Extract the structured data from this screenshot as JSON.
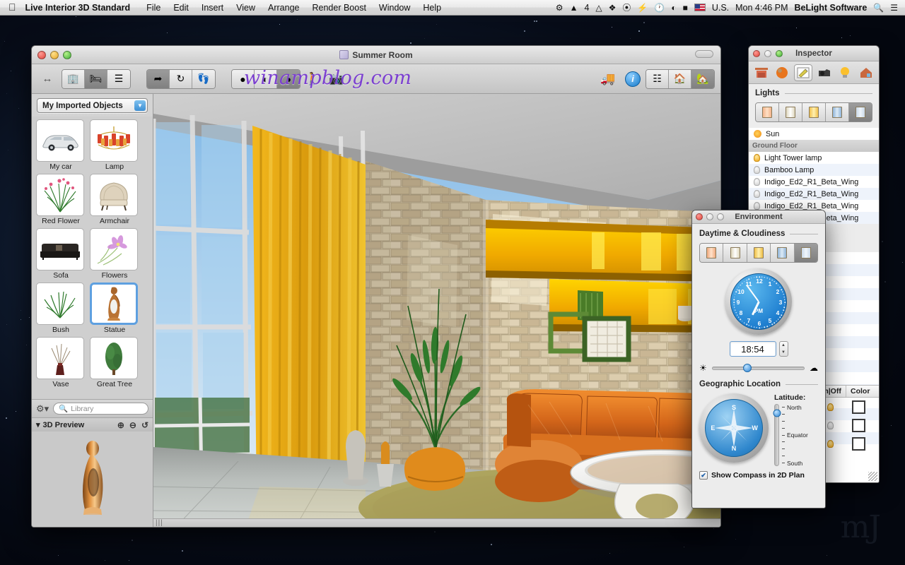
{
  "menubar": {
    "apple_icon": "apple-icon",
    "app_name": "Live Interior 3D Standard",
    "menus": [
      "File",
      "Edit",
      "Insert",
      "View",
      "Arrange",
      "Render Boost",
      "Window",
      "Help"
    ],
    "status_items": [
      {
        "icon": "shield-check-icon",
        "label": ""
      },
      {
        "icon": "adobe-icon",
        "label": "4"
      },
      {
        "icon": "google-drive-icon",
        "label": ""
      },
      {
        "icon": "dropbox-icon",
        "label": ""
      },
      {
        "icon": "leaf-icon",
        "label": ""
      },
      {
        "icon": "bolt-icon",
        "label": ""
      },
      {
        "icon": "clock-icon",
        "label": ""
      },
      {
        "icon": "wifi-icon",
        "label": ""
      },
      {
        "icon": "battery-icon",
        "label": ""
      }
    ],
    "input_flag": "us-flag-icon",
    "input_label": "U.S.",
    "datetime": "Mon 4:46 PM",
    "account": "BeLight Software",
    "search_icon": "search-icon",
    "notification_icon": "notification-center-icon"
  },
  "window": {
    "title": "Summer Room",
    "toolbar": {
      "resize_icon": "resize-arrow-icon",
      "left_segment": [
        {
          "icon": "building-icon",
          "active": false
        },
        {
          "icon": "armchair-icon",
          "active": true
        },
        {
          "icon": "list-icon",
          "active": false
        }
      ],
      "tool_segment": [
        {
          "icon": "arrow-pointer-icon",
          "active": true
        },
        {
          "icon": "rotate-icon",
          "active": false
        },
        {
          "icon": "footsteps-icon",
          "active": false
        }
      ],
      "shade_segment": [
        {
          "icon": "flat-shading-icon",
          "active": false
        },
        {
          "icon": "half-shading-icon",
          "active": false
        },
        {
          "icon": "full-shading-icon",
          "active": true
        }
      ],
      "walk_icon": "walk-person-icon",
      "camera_icon": "camera-icon",
      "forklift_icon": "forklift-icon",
      "info_icon": "i",
      "view_segment": [
        {
          "icon": "split-view-icon",
          "active": false
        },
        {
          "icon": "plan-and-3d-icon",
          "active": false
        },
        {
          "icon": "house-3d-icon",
          "active": true
        }
      ],
      "watermark": "winampblog.com"
    }
  },
  "library": {
    "category": "My Imported Objects",
    "dropdown_icon": "chevron-down-icon",
    "objects": [
      {
        "label": "My car",
        "icon": "car-icon",
        "selected": false
      },
      {
        "label": "Lamp",
        "icon": "chandelier-icon",
        "selected": false
      },
      {
        "label": "Red Flower",
        "icon": "red-flower-icon",
        "selected": false
      },
      {
        "label": "Armchair",
        "icon": "armchair-icon",
        "selected": false
      },
      {
        "label": "Sofa",
        "icon": "sofa-icon",
        "selected": false
      },
      {
        "label": "Flowers",
        "icon": "flowers-icon",
        "selected": false
      },
      {
        "label": "Bush",
        "icon": "bush-icon",
        "selected": false
      },
      {
        "label": "Statue",
        "icon": "statue-icon",
        "selected": true
      },
      {
        "label": "Vase",
        "icon": "vase-icon",
        "selected": false
      },
      {
        "label": "Great Tree",
        "icon": "tree-icon",
        "selected": false
      }
    ],
    "gear_icon": "gear-icon",
    "search_placeholder": "Library",
    "search_icon": "search-icon",
    "preview": {
      "title": "3D Preview",
      "disclosure_icon": "disclosure-triangle-icon",
      "zoom_in_icon": "zoom-in-icon",
      "zoom_out_icon": "zoom-out-icon",
      "rotate_icon": "rotate-icon"
    }
  },
  "inspector": {
    "title": "Inspector",
    "tabs": [
      {
        "icon": "building-plan-icon",
        "active": false
      },
      {
        "icon": "material-sphere-icon",
        "active": false
      },
      {
        "icon": "edit-pencil-icon",
        "active": true
      },
      {
        "icon": "camera-icon",
        "active": false
      },
      {
        "icon": "light-bulb-icon",
        "active": false
      },
      {
        "icon": "house-environment-icon",
        "active": false
      }
    ],
    "section_title": "Lights",
    "light_modes": [
      {
        "icon": "window-warm-icon",
        "active": false
      },
      {
        "icon": "window-neutral-icon",
        "active": false
      },
      {
        "icon": "window-yellow-icon",
        "active": false
      },
      {
        "icon": "window-cool-icon",
        "active": false
      },
      {
        "icon": "window-time-icon",
        "active": true
      }
    ],
    "lights": [
      {
        "name": "Sun",
        "state": "sun",
        "type": "item"
      },
      {
        "name": "Ground Floor",
        "state": "",
        "type": "section"
      },
      {
        "name": "Light Tower lamp",
        "state": "on",
        "type": "item"
      },
      {
        "name": "Bamboo Lamp",
        "state": "off",
        "type": "item"
      },
      {
        "name": "Indigo_Ed2_R1_Beta_Wing",
        "state": "off",
        "type": "item"
      },
      {
        "name": "Indigo_Ed2_R1_Beta_Wing",
        "state": "off",
        "type": "item"
      },
      {
        "name": "Indigo_Ed2_R1_Beta_Wing",
        "state": "off",
        "type": "item"
      },
      {
        "name": "Indigo_Ed2_R1_Beta_Wing",
        "state": "off",
        "type": "item"
      }
    ],
    "table": {
      "columns": [
        "",
        "On|Off",
        "Color"
      ],
      "rows": [
        {
          "on_icon": "bulb-on-icon",
          "color": "#ffffff"
        },
        {
          "on_icon": "bulb-off-icon",
          "color": "#ffffff"
        },
        {
          "on_icon": "bulb-on-icon",
          "color": "#ffffff"
        }
      ]
    }
  },
  "environment": {
    "title": "Environment",
    "daytime_title": "Daytime & Cloudiness",
    "daytime_modes": [
      {
        "icon": "window-warm-icon",
        "active": false
      },
      {
        "icon": "window-neutral-icon",
        "active": false
      },
      {
        "icon": "window-yellow-icon",
        "active": false
      },
      {
        "icon": "window-cool-icon",
        "active": false
      },
      {
        "icon": "window-time-icon",
        "active": true
      }
    ],
    "clock": {
      "numbers": [
        "12",
        "1",
        "2",
        "3",
        "4",
        "5",
        "6",
        "7",
        "8",
        "9",
        "10",
        "11"
      ],
      "ampm": "PM",
      "hour_angle": 206,
      "minute_angle": 324
    },
    "time_value": "18:54",
    "stepper_up_icon": "stepper-up-icon",
    "stepper_down_icon": "stepper-down-icon",
    "cloud_slider": {
      "sun_icon": "sun-icon",
      "cloud_icon": "cloud-icon",
      "position_pct": 38
    },
    "geo_title": "Geographic Location",
    "compass": {
      "n": "N",
      "e": "E",
      "s": "S",
      "w": "W"
    },
    "latitude_label": "Latitude:",
    "latitude_ticks": [
      "North",
      "",
      "",
      "",
      "Equator",
      "",
      "",
      "",
      "South"
    ],
    "latitude_knob_pct": 14,
    "checkbox": {
      "label": "Show Compass in 2D Plan",
      "checked": true,
      "mark": "✔"
    }
  },
  "desktop": {
    "corner_watermark": "mJ"
  }
}
